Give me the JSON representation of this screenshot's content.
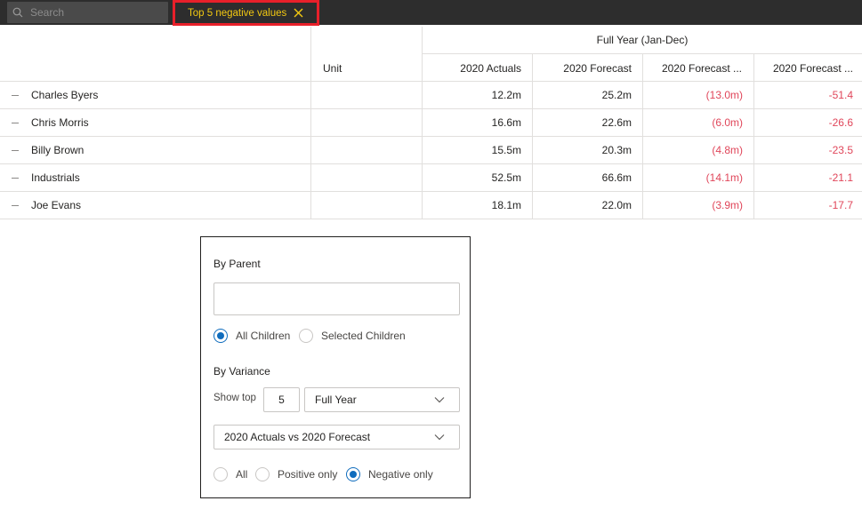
{
  "toolbar": {
    "search_placeholder": "Search",
    "active_filter_label": "Top 5 negative values"
  },
  "table": {
    "group_header": "Full Year (Jan-Dec)",
    "columns": [
      "Unit",
      "2020 Actuals",
      "2020 Forecast",
      "2020 Forecast ...",
      "2020 Forecast ..."
    ],
    "rows": [
      {
        "name": "Charles Byers",
        "unit": "",
        "actuals": "12.2m",
        "forecast": "25.2m",
        "variance": "(13.0m)",
        "variance_pct": "-51.4"
      },
      {
        "name": "Chris Morris",
        "unit": "",
        "actuals": "16.6m",
        "forecast": "22.6m",
        "variance": "(6.0m)",
        "variance_pct": "-26.6"
      },
      {
        "name": "Billy Brown",
        "unit": "",
        "actuals": "15.5m",
        "forecast": "20.3m",
        "variance": "(4.8m)",
        "variance_pct": "-23.5"
      },
      {
        "name": "Industrials",
        "unit": "",
        "actuals": "52.5m",
        "forecast": "66.6m",
        "variance": "(14.1m)",
        "variance_pct": "-21.1"
      },
      {
        "name": "Joe Evans",
        "unit": "",
        "actuals": "18.1m",
        "forecast": "22.0m",
        "variance": "(3.9m)",
        "variance_pct": "-17.7"
      }
    ]
  },
  "panel": {
    "by_parent_title": "By Parent",
    "parent_input_value": "",
    "children_options": [
      {
        "label": "All Children",
        "selected": true
      },
      {
        "label": "Selected Children",
        "selected": false
      }
    ],
    "by_variance_title": "By Variance",
    "show_top_label": "Show top",
    "show_top_value": "5",
    "period_selected": "Full Year",
    "comparison_selected": "2020 Actuals vs 2020 Forecast",
    "sign_options": [
      {
        "label": "All",
        "selected": false
      },
      {
        "label": "Positive only",
        "selected": false
      },
      {
        "label": "Negative only",
        "selected": true
      }
    ]
  },
  "colors": {
    "negative": "#e0465a",
    "accent": "#0f6cbd",
    "chip_text": "#f2c811",
    "chip_border": "#e8202a",
    "topbar": "#2d2d2d"
  }
}
